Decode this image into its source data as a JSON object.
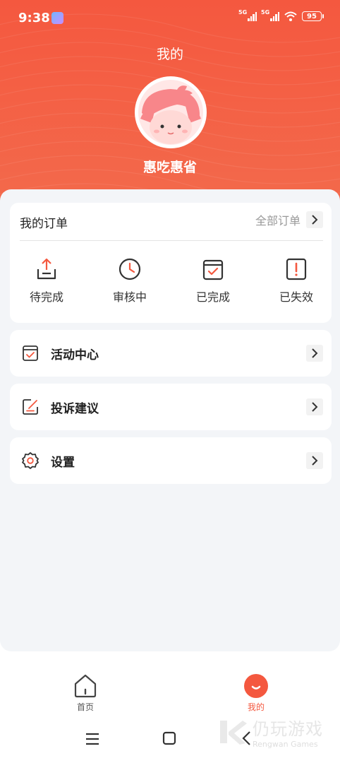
{
  "status_bar": {
    "time": "9:38",
    "signal1_label": "5G",
    "signal2_label": "5G",
    "battery": "95"
  },
  "header": {
    "title": "我的",
    "username": "惠吃惠省"
  },
  "orders": {
    "title": "我的订单",
    "all_label": "全部订单",
    "items": [
      {
        "label": "待完成",
        "icon": "upload-tray-icon"
      },
      {
        "label": "审核中",
        "icon": "clock-icon"
      },
      {
        "label": "已完成",
        "icon": "calendar-check-icon"
      },
      {
        "label": "已失效",
        "icon": "exclamation-icon"
      }
    ]
  },
  "menu": [
    {
      "label": "活动中心",
      "icon": "calendar-check-icon"
    },
    {
      "label": "投诉建议",
      "icon": "edit-note-icon"
    },
    {
      "label": "设置",
      "icon": "gear-icon"
    }
  ],
  "tabbar": {
    "tabs": [
      {
        "label": "首页",
        "icon": "home-icon",
        "active": false
      },
      {
        "label": "我的",
        "icon": "smile-icon",
        "active": true
      }
    ]
  },
  "watermark": {
    "cn": "仍玩游戏",
    "en": "Rengwan Games"
  },
  "colors": {
    "accent": "#f4583f",
    "background": "#f3f5f8",
    "text": "#222222",
    "muted": "#999999"
  }
}
